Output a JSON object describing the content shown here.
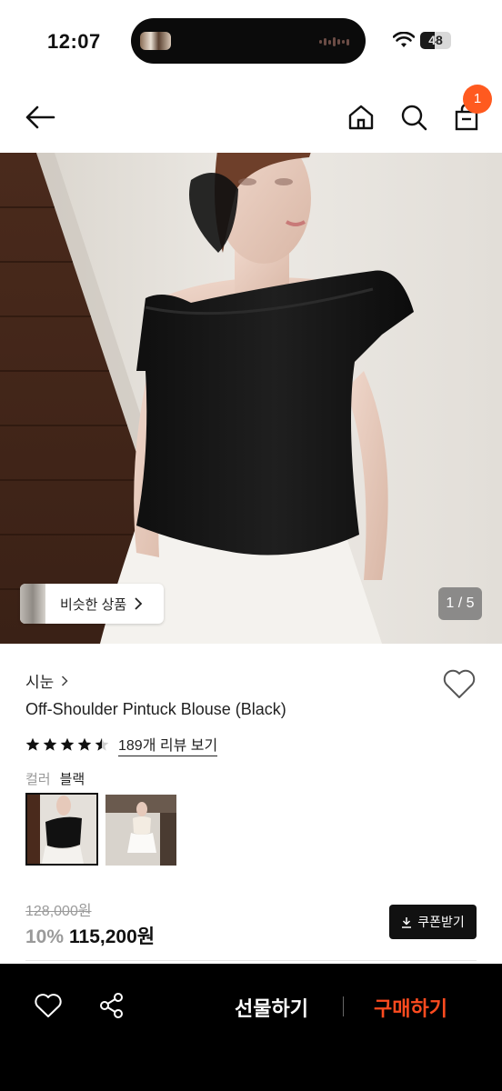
{
  "status_bar": {
    "time": "12:07",
    "battery": "48",
    "battery_level": 0.48
  },
  "header": {
    "cart_count": "1"
  },
  "hero": {
    "similar_label": "비슷한 상품",
    "counter": "1 / 5"
  },
  "product": {
    "brand": "시눈",
    "name": "Off-Shoulder Pintuck Blouse (Black)",
    "rating": 4.5,
    "review_link": "189개 리뷰 보기",
    "option_label": "컬러",
    "option_value": "블랙",
    "original_price": "128,000원",
    "discount": "10%",
    "price": "115,200원",
    "coupon_label": "쿠폰받기"
  },
  "bottom_bar": {
    "gift_label": "선물하기",
    "buy_label": "구매하기"
  },
  "colors": {
    "accent": "#ff5a1f",
    "buy": "#ff4b1f",
    "bar": "#000000"
  },
  "icons": [
    "back-arrow-icon",
    "home-icon",
    "search-icon",
    "shopping-bag-icon",
    "chevron-right-icon",
    "heart-icon",
    "star-icon",
    "download-icon",
    "share-icon",
    "wifi-icon",
    "battery-icon"
  ]
}
